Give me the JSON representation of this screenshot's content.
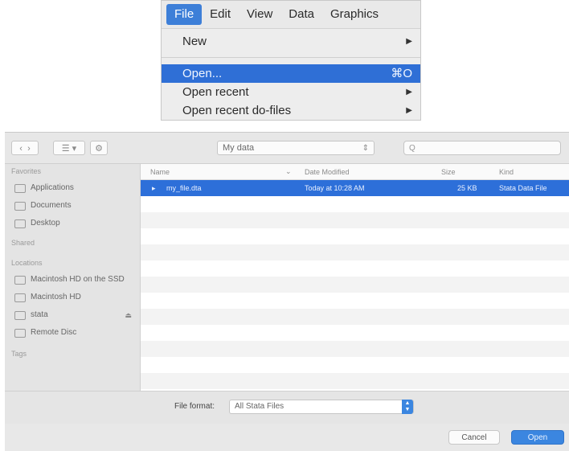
{
  "menu": {
    "bar": [
      "File",
      "Edit",
      "View",
      "Data",
      "Graphics"
    ],
    "items": {
      "new": "New",
      "open": "Open...",
      "open_shortcut": "⌘O",
      "open_recent": "Open recent",
      "open_recent_dofiles": "Open recent do-files"
    }
  },
  "dialog": {
    "toolbar": {
      "path": "My data",
      "search_placeholder": "Q"
    },
    "sidebar": {
      "favorites_header": "Favorites",
      "favorites": [
        "Applications",
        "Documents",
        "Desktop"
      ],
      "shared_header": "Shared",
      "locations_header": "Locations",
      "locations": [
        "Macintosh HD on the SSD",
        "Macintosh HD",
        "stata",
        "Remote Disc"
      ],
      "tags_header": "Tags"
    },
    "columns": [
      "Name",
      "Date Modified",
      "Size",
      "Kind"
    ],
    "files": [
      {
        "name": "my_file.dta",
        "date": "Today at 10:28 AM",
        "size": "25 KB",
        "kind": "Stata Data File"
      }
    ],
    "file_format_label": "File format:",
    "file_format_value": "All Stata Files",
    "cancel": "Cancel",
    "open": "Open"
  },
  "colors": {
    "accent": "#2f6fd6",
    "menu_bg": "#ededed",
    "dialog_bg": "#ececec"
  }
}
